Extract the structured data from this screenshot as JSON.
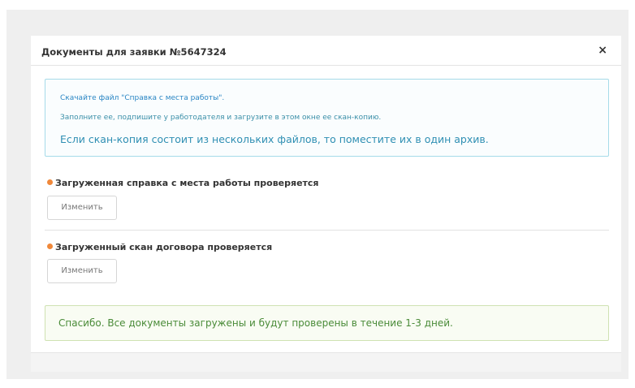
{
  "modal": {
    "title": "Документы для заявки №5647324",
    "close_label": "×"
  },
  "info": {
    "line1": "Скачайте файл \"Справка с места работы\".",
    "line2": "Заполните ее, подпишите у работодателя и загрузите в этом окне ее скан-копию.",
    "line3": "Если скан-копия состоит из нескольких файлов, то поместите их в один архив."
  },
  "documents": [
    {
      "status": "Загруженная справка с места работы проверяется",
      "button_label": "Изменить",
      "dot_color": "#f0883a"
    },
    {
      "status": "Загруженный скан договора проверяется",
      "button_label": "Изменить",
      "dot_color": "#f0883a"
    }
  ],
  "success": {
    "message": "Спасибо. Все документы загружены и будут проверены в течение 1-3 дней."
  }
}
